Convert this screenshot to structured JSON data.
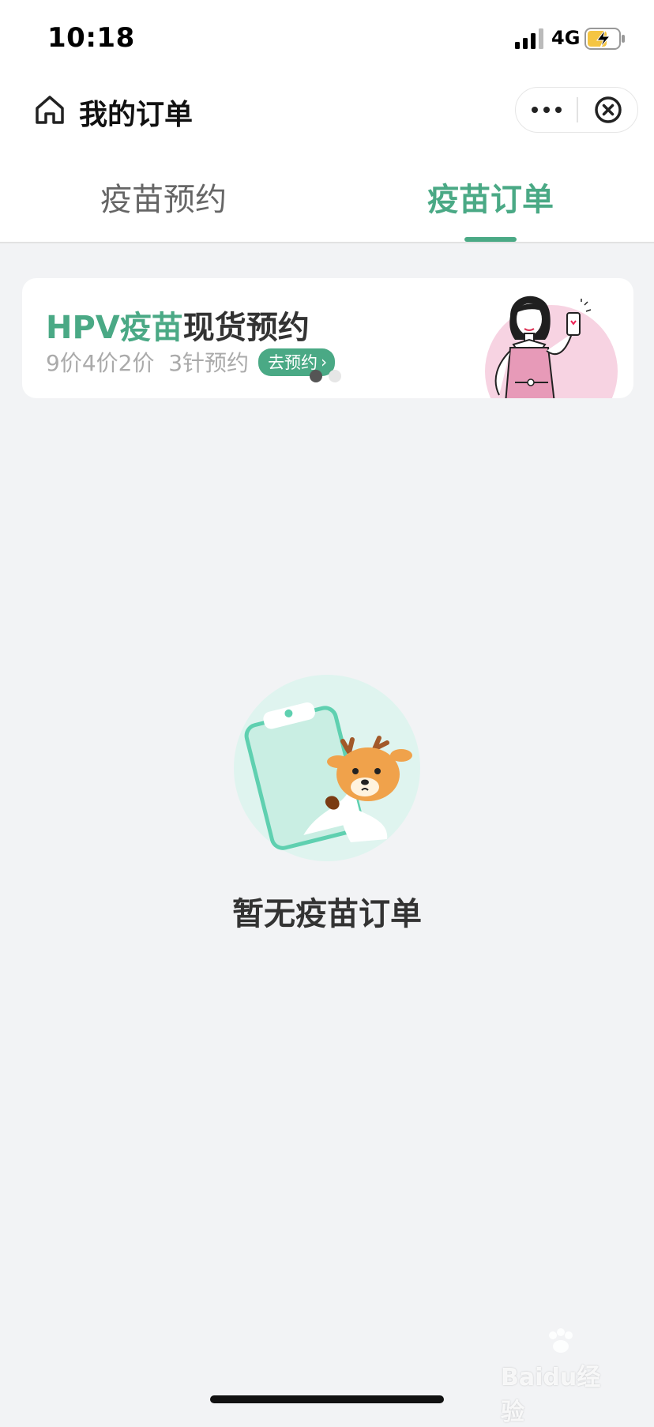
{
  "status_bar": {
    "time": "10:18",
    "network": "4G"
  },
  "header": {
    "title": "我的订单"
  },
  "tabs": [
    {
      "label": "疫苗预约",
      "active": false
    },
    {
      "label": "疫苗订单",
      "active": true
    }
  ],
  "banner": {
    "title_highlight": "HPV疫苗",
    "title_rest": "现货预约",
    "subtitle": "9价4价2价  3针预约",
    "button_label": "去预约",
    "carousel_dots": 2,
    "carousel_active": 1
  },
  "empty_state": {
    "message": "暂无疫苗订单"
  },
  "watermark": {
    "text": "Baidu经验"
  },
  "colors": {
    "accent": "#4aa985",
    "background": "#f2f3f5"
  }
}
